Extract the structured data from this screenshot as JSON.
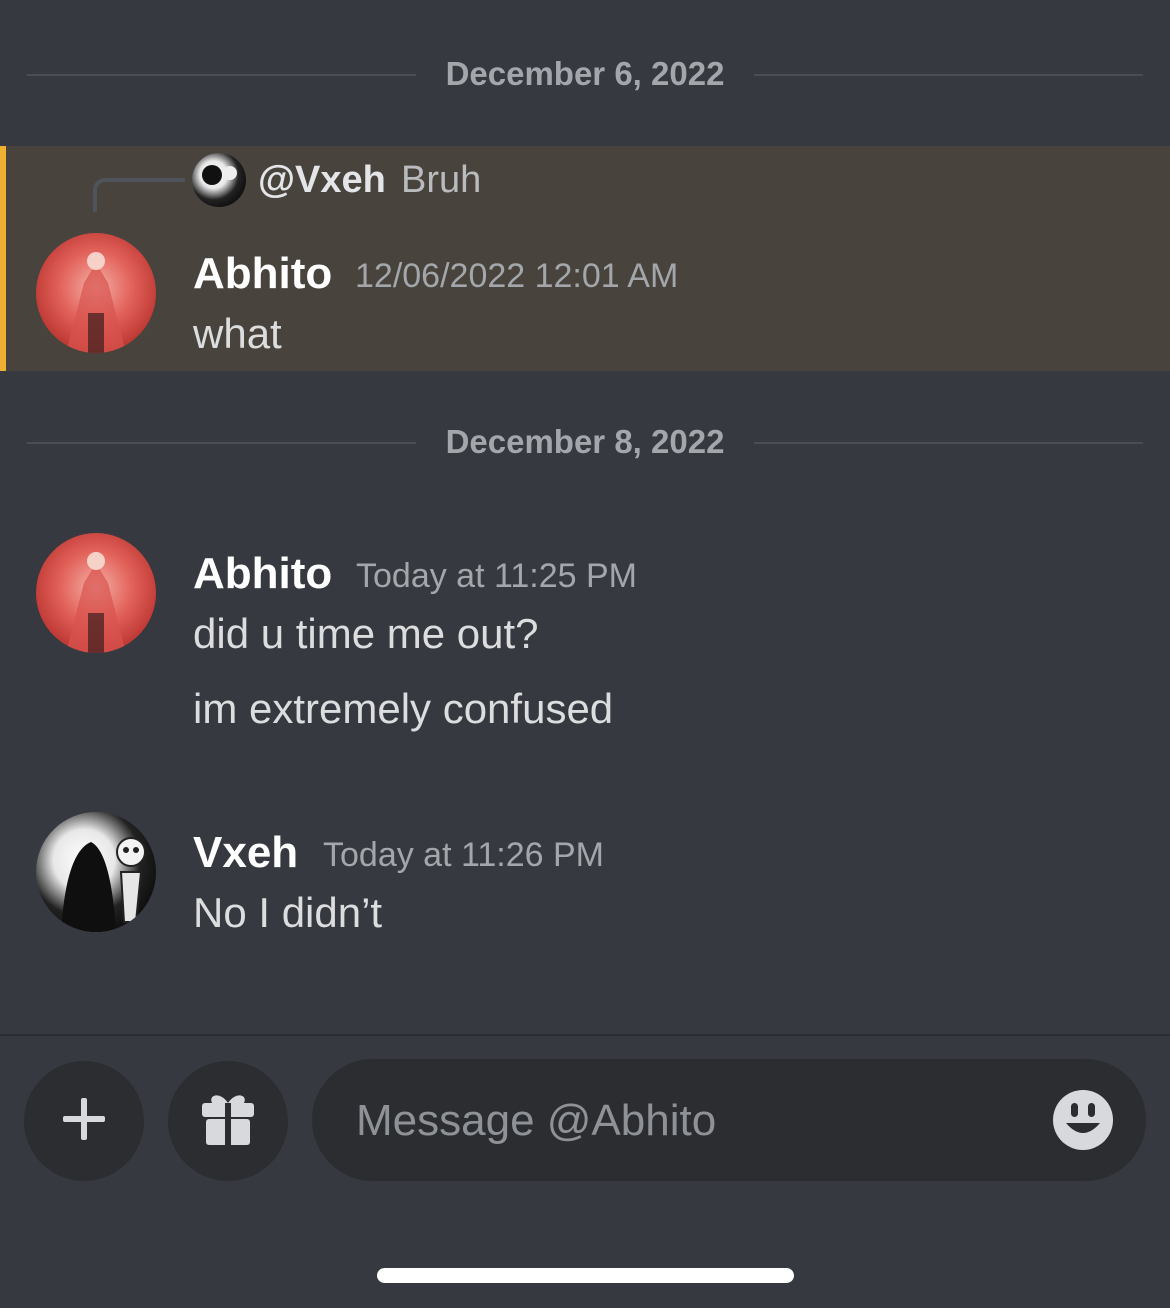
{
  "dividers": {
    "first": "December 6, 2022",
    "second": "December 8, 2022"
  },
  "reply": {
    "user": "@Vxeh",
    "text": "Bruh"
  },
  "messages": [
    {
      "author": "Abhito",
      "timestamp": "12/06/2022 12:01 AM",
      "lines": [
        "what"
      ]
    },
    {
      "author": "Abhito",
      "timestamp": "Today at 11:25 PM",
      "lines": [
        "did u time me out?",
        "im extremely confused"
      ]
    },
    {
      "author": "Vxeh",
      "timestamp": "Today at 11:26 PM",
      "lines": [
        "No I didn’t"
      ]
    }
  ],
  "composer": {
    "placeholder": "Message @Abhito",
    "add_icon": "plus-icon",
    "gift_icon": "gift-icon",
    "emoji_icon": "emoji-icon"
  },
  "colors": {
    "background": "#36393f",
    "highlight": "#48443d",
    "highlight_bar": "#f0b132",
    "input": "#2b2d31"
  }
}
